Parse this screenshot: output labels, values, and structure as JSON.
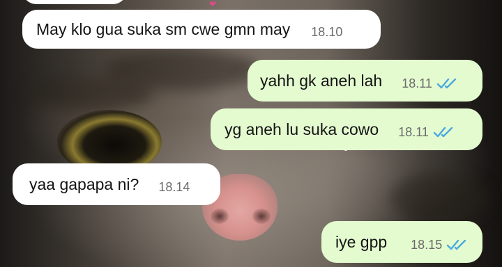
{
  "chat": {
    "colors": {
      "incoming_bubble": "#ffffff",
      "outgoing_bubble": "#e4fbd0",
      "read_check": "#4aa9e0",
      "timestamp": "#6b6b6b"
    },
    "messages": [
      {
        "direction": "incoming",
        "text": "May klo gua suka sm cwe gmn may",
        "time": "18.10"
      },
      {
        "direction": "outgoing",
        "text": "yahh gk aneh lah",
        "time": "18.11",
        "status": "read-double-check-icon"
      },
      {
        "direction": "outgoing",
        "text": "yg aneh lu suka cowo",
        "time": "18.11",
        "status": "read-double-check-icon"
      },
      {
        "direction": "incoming",
        "text": "yaa gapapa ni?",
        "time": "18.14"
      },
      {
        "direction": "outgoing",
        "text": "iye gpp",
        "time": "18.15",
        "status": "read-double-check-icon"
      }
    ]
  }
}
